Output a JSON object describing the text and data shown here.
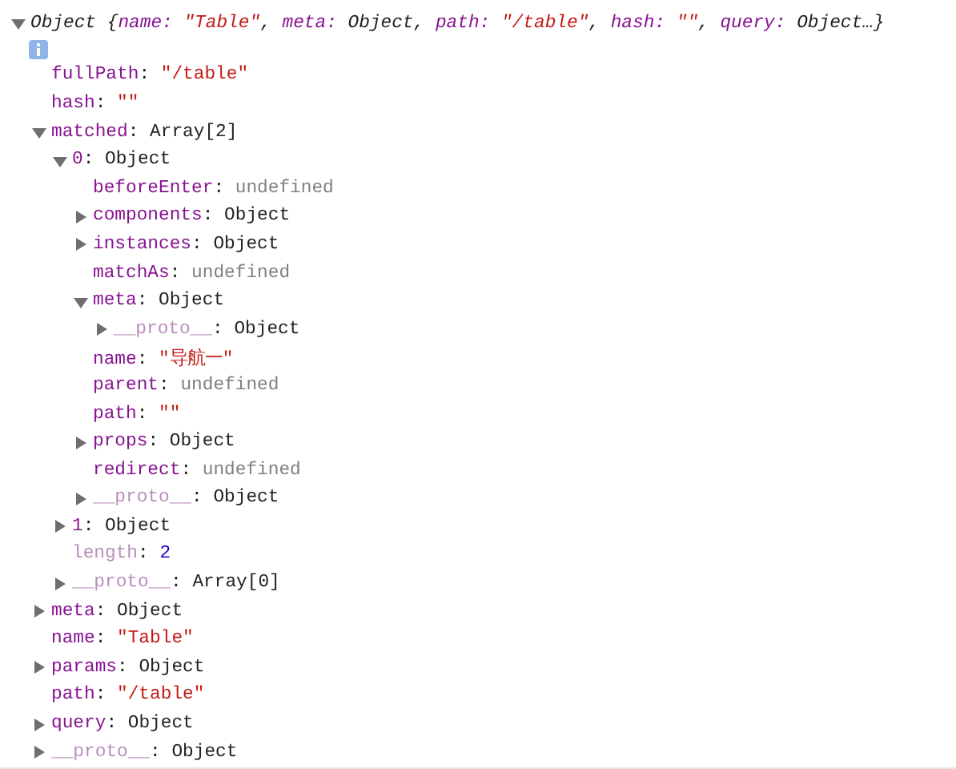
{
  "summary": {
    "expanded": true,
    "segments": [
      {
        "text": "Object {",
        "kind": "plain"
      },
      {
        "text": "name:",
        "kind": "key"
      },
      {
        "text": " \"Table\"",
        "kind": "string"
      },
      {
        "text": ", ",
        "kind": "plain"
      },
      {
        "text": "meta:",
        "kind": "key"
      },
      {
        "text": " Object, ",
        "kind": "plain"
      },
      {
        "text": "path:",
        "kind": "key"
      },
      {
        "text": " \"/table\"",
        "kind": "string"
      },
      {
        "text": ", ",
        "kind": "plain"
      },
      {
        "text": "hash:",
        "kind": "key"
      },
      {
        "text": " \"\"",
        "kind": "string"
      },
      {
        "text": ", ",
        "kind": "plain"
      },
      {
        "text": "query:",
        "kind": "key"
      },
      {
        "text": " Object…}",
        "kind": "plain"
      }
    ]
  },
  "properties": [
    {
      "key": "fullPath:",
      "value": "\"/table\"",
      "kind": "string",
      "internal": false
    },
    {
      "key": "hash:",
      "value": "\"\"",
      "kind": "string",
      "internal": false
    },
    {
      "key": "matched:",
      "value": "Array[2]",
      "kind": "object",
      "internal": false,
      "expanded": true,
      "children": [
        {
          "key": "0:",
          "value": "Object",
          "kind": "object",
          "internal": false,
          "expanded": true,
          "children": [
            {
              "key": "beforeEnter:",
              "value": "undefined",
              "kind": "undefined",
              "internal": false
            },
            {
              "key": "components:",
              "value": "Object",
              "kind": "object",
              "internal": false,
              "expanded": false
            },
            {
              "key": "instances:",
              "value": "Object",
              "kind": "object",
              "internal": false,
              "expanded": false
            },
            {
              "key": "matchAs:",
              "value": "undefined",
              "kind": "undefined",
              "internal": false
            },
            {
              "key": "meta:",
              "value": "Object",
              "kind": "object",
              "internal": false,
              "expanded": true,
              "children": [
                {
                  "key": "__proto__:",
                  "value": "Object",
                  "kind": "object",
                  "internal": true,
                  "expanded": false
                }
              ]
            },
            {
              "key": "name:",
              "value": "\"导航一\"",
              "kind": "string",
              "internal": false
            },
            {
              "key": "parent:",
              "value": "undefined",
              "kind": "undefined",
              "internal": false
            },
            {
              "key": "path:",
              "value": "\"\"",
              "kind": "string",
              "internal": false
            },
            {
              "key": "props:",
              "value": "Object",
              "kind": "object",
              "internal": false,
              "expanded": false
            },
            {
              "key": "redirect:",
              "value": "undefined",
              "kind": "undefined",
              "internal": false
            },
            {
              "key": "__proto__:",
              "value": "Object",
              "kind": "object",
              "internal": true,
              "expanded": false
            }
          ]
        },
        {
          "key": "1:",
          "value": "Object",
          "kind": "object",
          "internal": false,
          "expanded": false
        },
        {
          "key": "length:",
          "value": "2",
          "kind": "number",
          "internal": true
        },
        {
          "key": "__proto__:",
          "value": "Array[0]",
          "kind": "object",
          "internal": true,
          "expanded": false
        }
      ]
    },
    {
      "key": "meta:",
      "value": "Object",
      "kind": "object",
      "internal": false,
      "expanded": false
    },
    {
      "key": "name:",
      "value": "\"Table\"",
      "kind": "string",
      "internal": false
    },
    {
      "key": "params:",
      "value": "Object",
      "kind": "object",
      "internal": false,
      "expanded": false
    },
    {
      "key": "path:",
      "value": "\"/table\"",
      "kind": "string",
      "internal": false
    },
    {
      "key": "query:",
      "value": "Object",
      "kind": "object",
      "internal": false,
      "expanded": false
    },
    {
      "key": "__proto__:",
      "value": "Object",
      "kind": "object",
      "internal": true,
      "expanded": false
    }
  ]
}
